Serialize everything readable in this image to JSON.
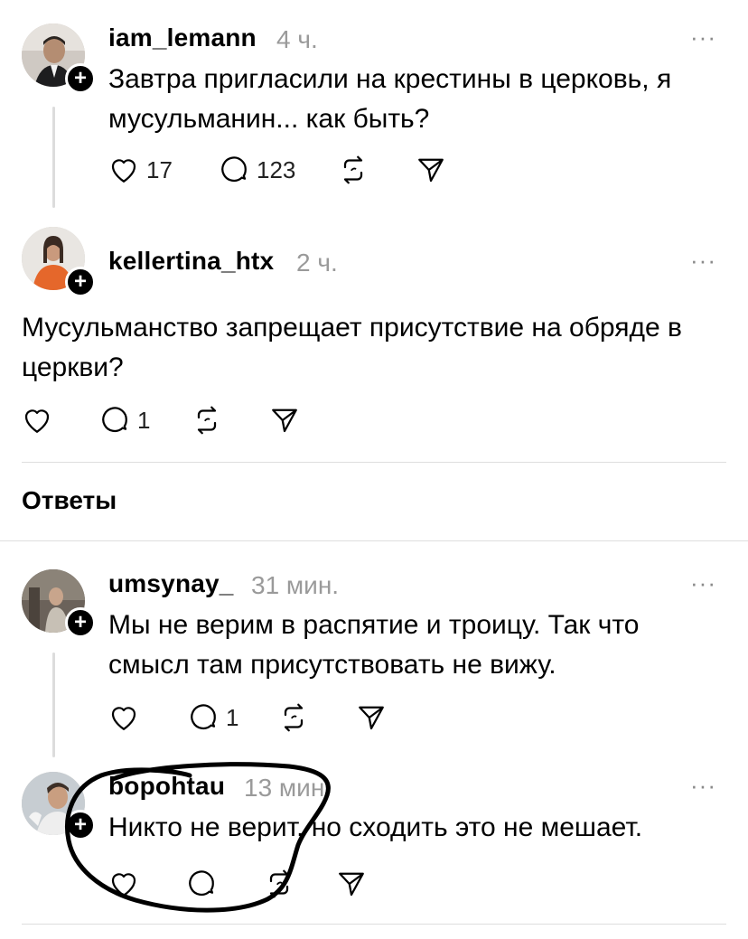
{
  "posts": [
    {
      "username": "iam_lemann",
      "time": "4 ч.",
      "text_lines": [
        "Завтра пригласили на крестины в церковь, я",
        "мусульманин... как быть?"
      ],
      "likes": "17",
      "replies": "123"
    },
    {
      "username": "kellertina_htx",
      "time": "2 ч.",
      "text_lines": [
        "Мусульманство запрещает присутствие на обряде в",
        "церкви?"
      ],
      "likes": "",
      "replies": "1"
    }
  ],
  "replies_header": "Ответы",
  "replies": [
    {
      "username": "umsynay_",
      "time": "31 мин.",
      "text_lines": [
        "Мы не верим в распятие и троицу. Так что",
        "смысл там присутствовать не вижу."
      ],
      "likes": "",
      "replies": "1"
    },
    {
      "username": "bopohtau",
      "time": "13 мин.",
      "text_lines": [
        "Никто не верит, но сходить это не мешает."
      ],
      "likes": "",
      "replies": ""
    }
  ],
  "more_label": "···",
  "plus_label": "+",
  "icons": {
    "like": "heart-icon",
    "reply": "comment-icon",
    "repost": "repost-icon",
    "share": "send-icon"
  },
  "colors": {
    "text": "#000000",
    "muted": "#9a9a9a",
    "divider": "#dedede",
    "annotation": "#000000"
  }
}
